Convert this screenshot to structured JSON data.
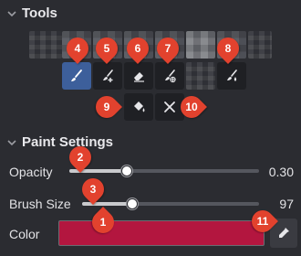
{
  "tools_section": {
    "title": "Tools"
  },
  "tool_buttons": {
    "brush": {
      "icon": "brush-icon",
      "active": true
    },
    "brush_add": {
      "icon": "brush-add-icon"
    },
    "eraser": {
      "icon": "eraser-icon"
    },
    "brush_target": {
      "icon": "brush-target-icon"
    },
    "brush_drop": {
      "icon": "brush-drop-icon"
    },
    "fill": {
      "icon": "paint-bucket-icon"
    },
    "clear": {
      "icon": "close-icon"
    }
  },
  "markers": [
    "4",
    "5",
    "6",
    "7",
    "8",
    "9",
    "10",
    "2",
    "3",
    "1",
    "11"
  ],
  "paint_section": {
    "title": "Paint Settings"
  },
  "opacity": {
    "label": "Opacity",
    "value": "0.30",
    "level": 0.3
  },
  "brush_size": {
    "label": "Brush Size",
    "value": "97",
    "level": 0.28
  },
  "color": {
    "label": "Color",
    "swatch": "#b3163f"
  },
  "eyedropper": {
    "icon": "eyedropper-icon"
  },
  "colors": {
    "active_tool": "#3d5f9b",
    "marker": "#e2422e",
    "panel_bg": "#2b2c31"
  }
}
